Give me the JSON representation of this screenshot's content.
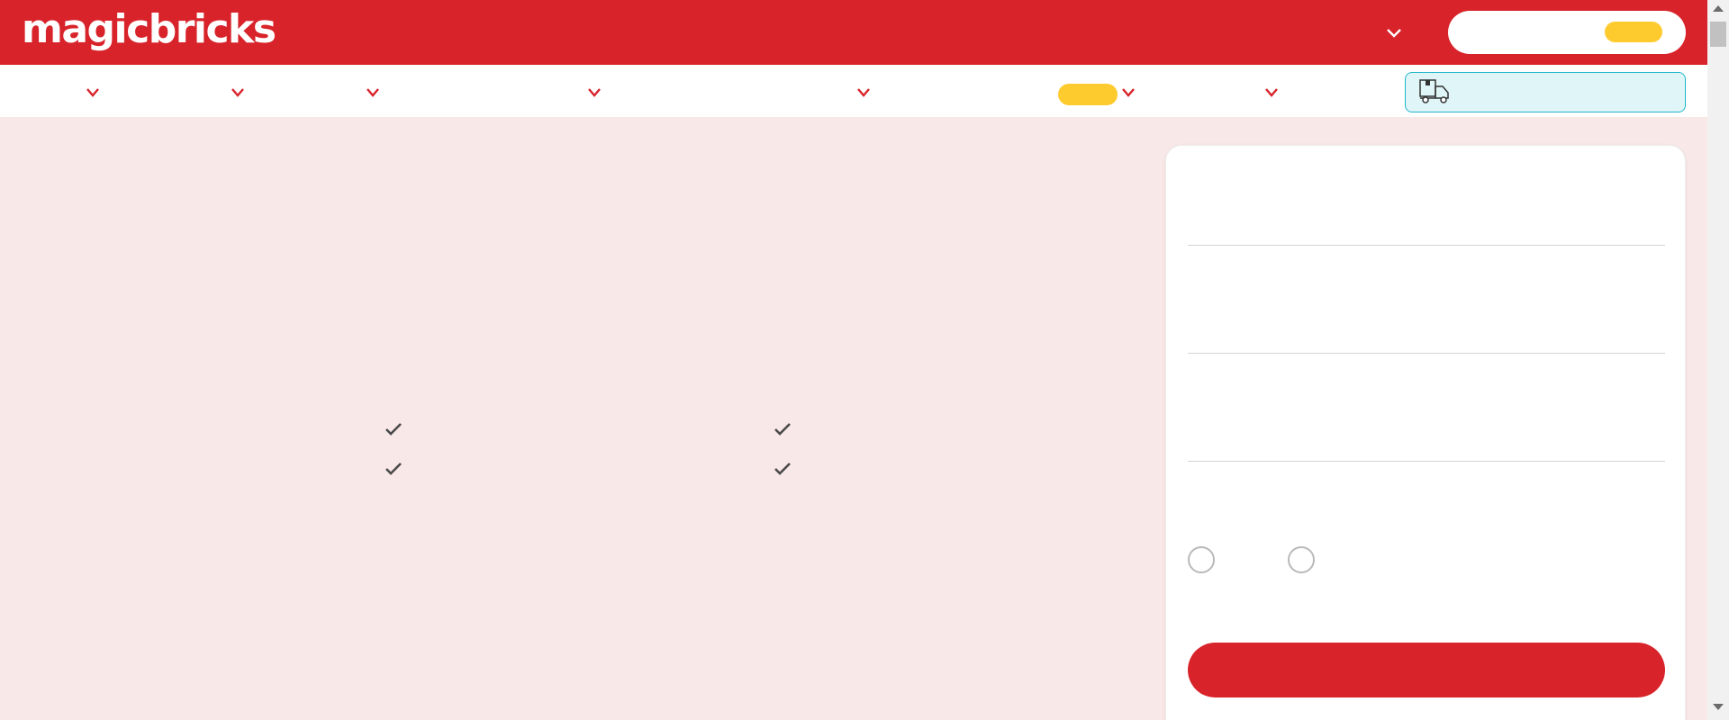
{
  "header": {
    "logo_text": "magicbricks",
    "dropdown_icon": "chevron-down-icon",
    "background_color": "#d8232a"
  },
  "nav": {
    "items": [
      {
        "icon": "chevron-down-icon"
      },
      {
        "icon": "chevron-down-icon"
      },
      {
        "icon": "chevron-down-icon"
      },
      {
        "icon": "chevron-down-icon"
      },
      {
        "icon": "chevron-down-icon"
      },
      {
        "icon": "chevron-down-icon"
      },
      {
        "icon": "chevron-down-icon"
      }
    ],
    "cta_icon": "delivery-truck-icon",
    "cta_colors": {
      "background": "#dff5f8",
      "border": "#20b6c8"
    }
  },
  "features": {
    "check_icon": "checkmark-icon"
  },
  "form": {
    "radio_options": 2,
    "submit_color": "#d8232a"
  },
  "colors": {
    "accent_red": "#d8232a",
    "badge_yellow": "#fecb2f",
    "page_background": "#f9e8e8"
  }
}
